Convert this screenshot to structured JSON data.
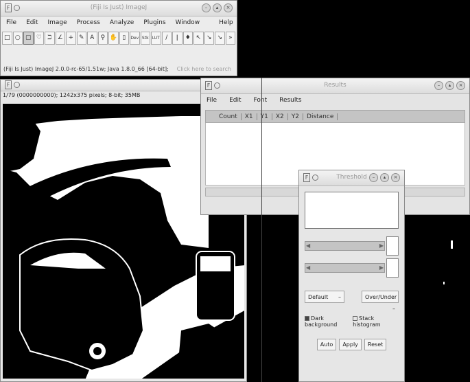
{
  "fiji": {
    "title": "(Fiji Is Just) ImageJ",
    "menu": [
      "File",
      "Edit",
      "Image",
      "Process",
      "Analyze",
      "Plugins",
      "Window",
      "Help"
    ],
    "tools": [
      {
        "name": "rectangle-tool-icon",
        "glyph": "□"
      },
      {
        "name": "oval-tool-icon",
        "glyph": "○"
      },
      {
        "name": "rounded-rect-tool-icon",
        "glyph": "▢"
      },
      {
        "name": "freehand-tool-icon",
        "glyph": "♡"
      },
      {
        "name": "polyline-tool-icon",
        "glyph": "ℶ"
      },
      {
        "name": "angle-tool-icon",
        "glyph": "∠"
      },
      {
        "name": "point-tool-icon",
        "glyph": "+"
      },
      {
        "name": "wand-tool-icon",
        "glyph": "✎"
      },
      {
        "name": "text-tool-icon",
        "glyph": "A"
      },
      {
        "name": "magnifier-tool-icon",
        "glyph": "⚲"
      },
      {
        "name": "hand-tool-icon",
        "glyph": "✋"
      },
      {
        "name": "dropper-tool-icon",
        "glyph": "▯"
      },
      {
        "name": "dev-tool-icon",
        "glyph": "Dev"
      },
      {
        "name": "stk-tool-icon",
        "glyph": "Stk"
      },
      {
        "name": "lut-tool-icon",
        "glyph": "LUT"
      },
      {
        "name": "pencil-tool-icon",
        "glyph": "/"
      },
      {
        "name": "brush-tool-icon",
        "glyph": "ǀ"
      },
      {
        "name": "flood-fill-tool-icon",
        "glyph": "♦"
      },
      {
        "name": "pin-tool-icon",
        "glyph": "↖"
      },
      {
        "name": "arrow-tool-icon",
        "glyph": "↘"
      },
      {
        "name": "arrow2-tool-icon",
        "glyph": "↘"
      },
      {
        "name": "more-tools-icon",
        "glyph": "»"
      }
    ],
    "status": "(Fiji Is Just) ImageJ 2.0.0-rc-65/1.51w; Java 1.8.0_66 [64-bit];",
    "search": "Click here to search"
  },
  "image_window": {
    "info": "1/79 (0000000000); 1242x375 pixels; 8-bit; 35MB"
  },
  "results": {
    "title": "Results",
    "menu": [
      "File",
      "Edit",
      "Font",
      "Results"
    ],
    "columns": [
      "Count",
      "X1",
      "Y1",
      "X2",
      "Y2",
      "Distance"
    ]
  },
  "threshold": {
    "title": "Threshold",
    "method": "Default",
    "mode": "Over/Under",
    "dark_background": "Dark background",
    "stack_histogram": "Stack histogram",
    "buttons": [
      "Auto",
      "Apply",
      "Reset"
    ]
  }
}
